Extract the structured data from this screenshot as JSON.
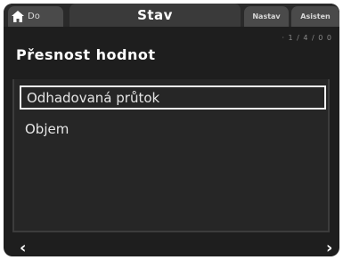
{
  "tabs": {
    "home_label": "Do",
    "active_label": "Stav",
    "nastav_label": "Nastav",
    "asist_label": "Asisten"
  },
  "status_note": "· 1 / 4 / 0 0",
  "page": {
    "title": "Přesnost hodnot"
  },
  "list": {
    "items": [
      {
        "label": "Odhadovaná průtok"
      },
      {
        "label": "Objem"
      }
    ],
    "selected_index": 0
  },
  "nav": {
    "prev": "‹",
    "next": "›"
  },
  "colors": {
    "background": "#1e1e1e",
    "tab_active": "#3a3a3a",
    "tab_inactive": "#4a4a4a",
    "selection_border": "#f0f0f0",
    "text": "#ffffff"
  },
  "icons": [
    "home-icon",
    "chevron-left-icon",
    "chevron-right-icon"
  ]
}
